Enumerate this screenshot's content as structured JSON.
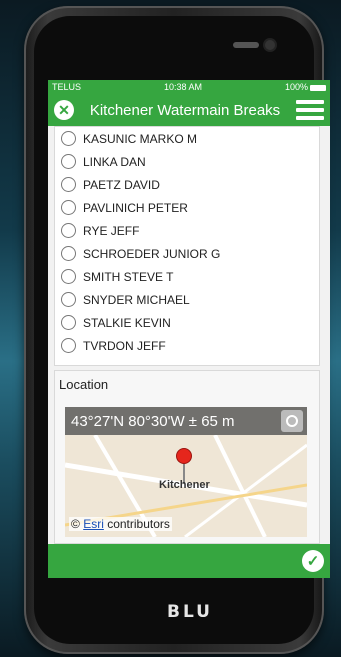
{
  "statusbar": {
    "carrier": "TELUS",
    "time": "10:38 AM",
    "battery": "100%"
  },
  "appbar": {
    "title": "Kitchener Watermain Breaks"
  },
  "list": {
    "items": [
      {
        "label": "KASUNIC MARKO M"
      },
      {
        "label": "LINKA DAN"
      },
      {
        "label": "PAETZ DAVID"
      },
      {
        "label": "PAVLINICH PETER"
      },
      {
        "label": "RYE JEFF"
      },
      {
        "label": "SCHROEDER JUNIOR G"
      },
      {
        "label": "SMITH STEVE T"
      },
      {
        "label": "SNYDER MICHAEL"
      },
      {
        "label": "STALKIE KEVIN"
      },
      {
        "label": "TVRDON JEFF"
      }
    ]
  },
  "location": {
    "label": "Location",
    "coords": "43°27'N 80°30'W ± 65 m",
    "city": "Kitchener",
    "attribution_prefix": "©",
    "attribution_link": "Esri",
    "attribution_suffix": "contributors"
  },
  "device": {
    "brand": "BLU"
  },
  "colors": {
    "accent": "#36a640"
  }
}
